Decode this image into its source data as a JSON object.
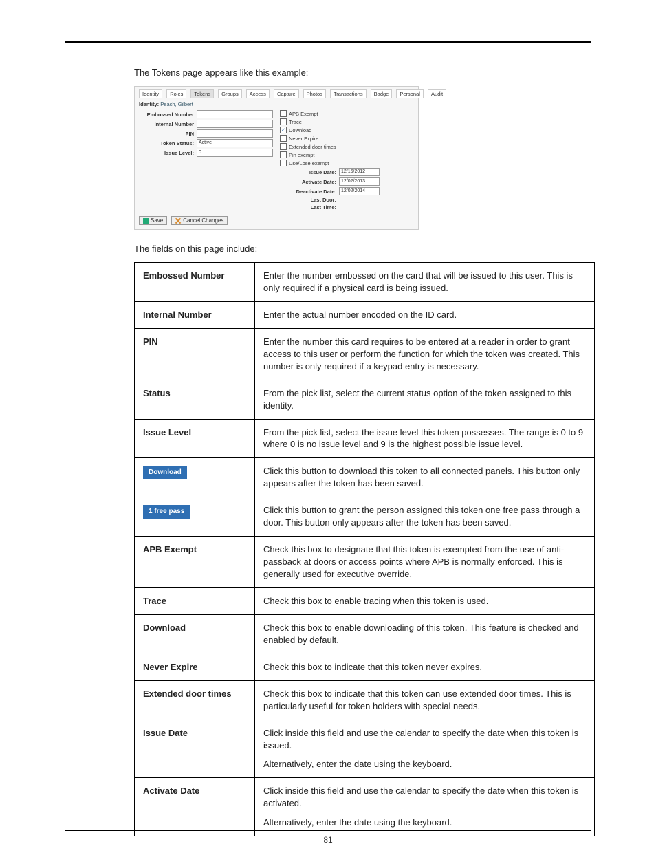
{
  "intro1": "The Tokens page appears like this example:",
  "intro2": "The fields on this page include:",
  "page_number": "81",
  "shot": {
    "tabs": [
      "Identity",
      "Roles",
      "Tokens",
      "Groups",
      "Access",
      "Capture",
      "Photos",
      "Transactions",
      "Badge",
      "Personal",
      "Audit"
    ],
    "active_tab_index": 2,
    "identity_label": "Identity:",
    "identity_link": "Peach, Gilbert",
    "fields": {
      "embossed": {
        "label": "Embossed Number",
        "value": ""
      },
      "internal": {
        "label": "Internal Number",
        "value": ""
      },
      "pin": {
        "label": "PIN",
        "value": ""
      },
      "status": {
        "label": "Token Status:",
        "value": "Active"
      },
      "level": {
        "label": "Issue Level:",
        "value": "0"
      }
    },
    "checks": [
      {
        "label": "APB Exempt",
        "checked": false
      },
      {
        "label": "Trace",
        "checked": false
      },
      {
        "label": "Download",
        "checked": true
      },
      {
        "label": "Never Expire",
        "checked": false
      },
      {
        "label": "Extended door times",
        "checked": false
      },
      {
        "label": "Pin exempt",
        "checked": false
      },
      {
        "label": "Use/Lose exempt",
        "checked": false
      }
    ],
    "dates": {
      "issue": {
        "label": "Issue Date:",
        "value": "12/16/2012"
      },
      "activate": {
        "label": "Activate Date:",
        "value": "12/02/2013"
      },
      "deactivate": {
        "label": "Deactivate Date:",
        "value": "12/02/2014"
      },
      "last_door": {
        "label": "Last Door:",
        "value": ""
      },
      "last_time": {
        "label": "Last Time:",
        "value": ""
      }
    },
    "save": "Save",
    "cancel": "Cancel Changes"
  },
  "table": [
    {
      "label": "Embossed Number",
      "desc": "Enter the number embossed on the card that will be issued to this user. This is only required if a physical card is being issued."
    },
    {
      "label": "Internal Number",
      "desc": "Enter the actual number encoded on the ID card."
    },
    {
      "label": "PIN",
      "desc": "Enter the number this card requires to be entered at a reader in order to grant access to this user or perform the function for which the token was created. This number is only required if a keypad entry is necessary."
    },
    {
      "label": "Status",
      "desc": "From the pick list, select the current status option of the token assigned to this identity."
    },
    {
      "label": "Issue Level",
      "desc": "From the pick list, select the issue level this token possesses. The range is 0 to 9 where 0 is no issue level and 9 is the highest possible issue level."
    },
    {
      "button": "Download",
      "desc": "Click this button to download this token to all connected panels. This button only appears after the token has been saved."
    },
    {
      "button": "1 free pass",
      "desc": "Click this button to grant the person assigned this token one free pass through a door. This button only appears after the token has been saved."
    },
    {
      "label": "APB Exempt",
      "desc": "Check this box to designate that this token is exempted from the use of anti-passback at doors or access points where APB is normally enforced. This is generally used for executive override."
    },
    {
      "label": "Trace",
      "desc": "Check this box to enable tracing when this token is used."
    },
    {
      "label": "Download",
      "desc": "Check this box to enable downloading of this token. This feature is checked and enabled by default."
    },
    {
      "label": "Never Expire",
      "desc": "Check this box to indicate that this token never expires."
    },
    {
      "label": "Extended door times",
      "desc": "Check this box to indicate that this token can use extended door times. This is particularly useful for token holders with special needs."
    },
    {
      "label": "Issue Date",
      "desc": "Click inside this field and use the calendar to specify the date when this token is issued.",
      "desc2": "Alternatively, enter the date using the keyboard."
    },
    {
      "label": "Activate Date",
      "desc": "Click inside this field and use the calendar to specify the date when this token is activated.",
      "desc2": "Alternatively, enter the date using the keyboard."
    }
  ]
}
